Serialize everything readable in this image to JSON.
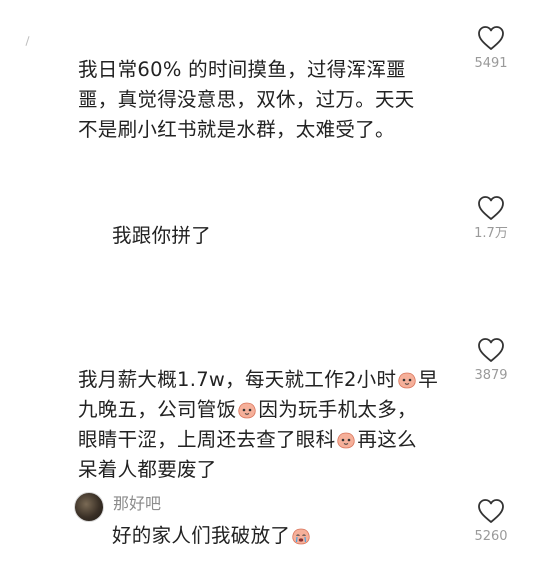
{
  "comments": [
    {
      "lines": [
        "我日常60% 的时间摸鱼，过得浑浑噩",
        "噩，真觉得没意思，双休，过万。天天",
        "不是刷小红书就是水群，太难受了。"
      ],
      "like_count": "5491"
    },
    {
      "lines": [
        "我跟你拼了"
      ],
      "like_count": "1.7万"
    },
    {
      "line1_a": "我月薪大概1.7w，每天就工作2小时",
      "line1_b": "早",
      "line2_a": "九晚五，公司管饭",
      "line2_b": "因为玩手机太多，",
      "line3_a": "眼睛干涩，上周还去查了眼科",
      "line3_b": "再这么",
      "line4": "呆着人都要废了",
      "emoji_name": "peach-face-emoji",
      "like_count": "3879"
    },
    {
      "username": "那好吧",
      "text": "好的家人们我破放了",
      "emoji_name": "crying-peach-emoji",
      "like_count": "5260"
    }
  ],
  "icons": {
    "like": "heart-outline-icon",
    "avatar": "user-avatar"
  },
  "colors": {
    "text": "#222222",
    "meta": "#9a9a9a",
    "emoji": "#f4a48a"
  }
}
